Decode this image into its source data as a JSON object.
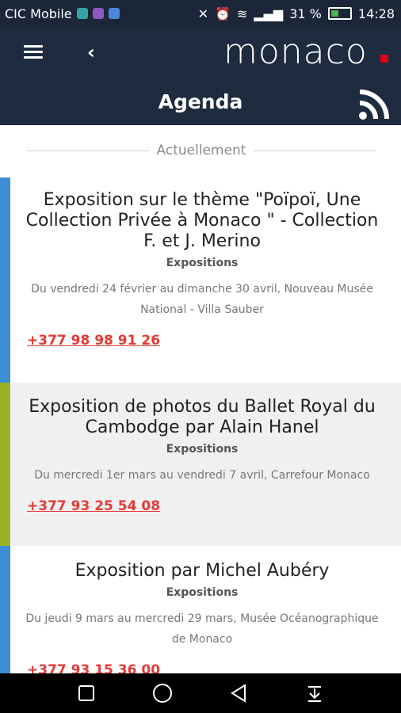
{
  "status_bar": {
    "carrier": "CIC Mobile",
    "battery": "31 %",
    "time": "14:28",
    "notification_icons": [
      "app-icon-teal",
      "app-icon-purple",
      "app-icon-blue"
    ]
  },
  "header": {
    "logo": "monaco",
    "title": "Agenda"
  },
  "section": {
    "label": "Actuellement"
  },
  "events": [
    {
      "title": "Exposition sur le thème \"Poïpoï, Une Collection Privée à Monaco \" - Collection F. et J. Merino",
      "category": "Expositions",
      "description": "Du vendredi 24 février au dimanche 30 avril, Nouveau Musée National - Villa Sauber",
      "phone": "+377 98 98 91 26",
      "accent": "#3d8ed6"
    },
    {
      "title": "Exposition de photos du Ballet Royal du Cambodge par Alain Hanel",
      "category": "Expositions",
      "description": "Du mercredi 1er mars au vendredi 7 avril, Carrefour Monaco",
      "phone": "+377 93 25 54 08",
      "accent": "#9ab226"
    },
    {
      "title": "Exposition par Michel Aubéry",
      "category": "Expositions",
      "description": "Du jeudi 9 mars au mercredi 29 mars, Musée Océanographique de Monaco",
      "phone": "+377 93 15 36 00",
      "accent": "#3d8ed6"
    }
  ],
  "colors": {
    "header_bg": "#1f2b3e",
    "status_bg": "#1b2638",
    "phone": "#e53935",
    "logo_dot": "#e2001a"
  }
}
